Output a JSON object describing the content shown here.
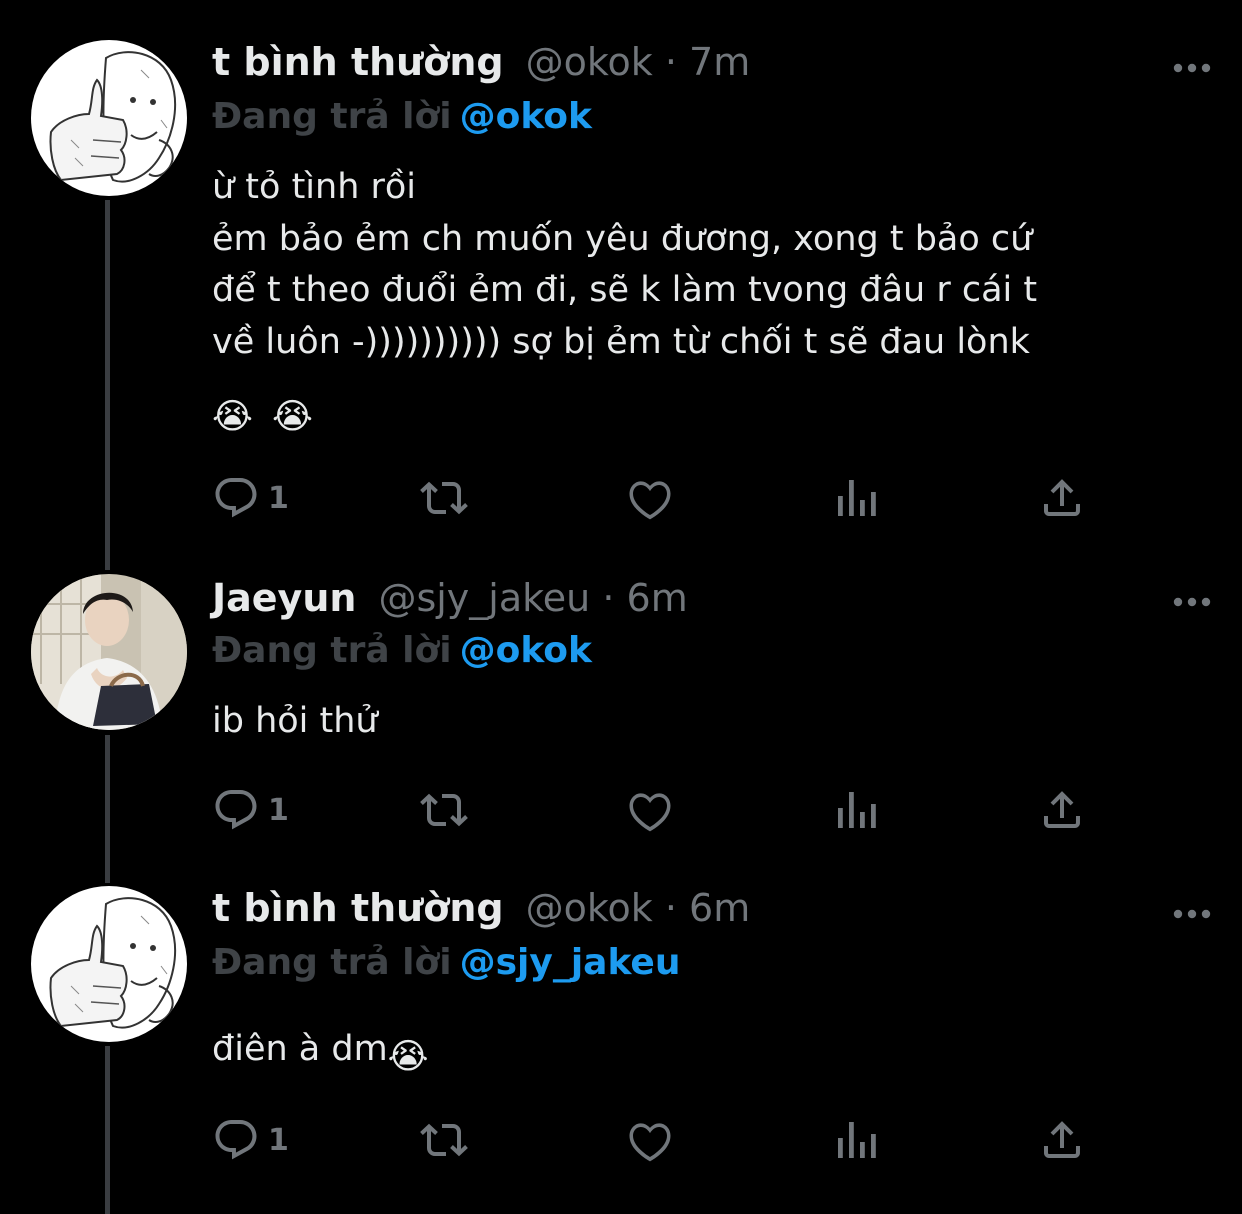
{
  "tweets": [
    {
      "display_name": "t bình thường",
      "handle": "@okok",
      "time": "7m",
      "reply_label": "Đang trả lời",
      "reply_to": "@okok",
      "body_lines": [
        "ừ tỏ tình rồi",
        "ẻm bảo ẻm ch muốn yêu đương, xong t bảo cứ",
        "để t theo đuổi ẻm đi, sẽ k làm tvong đâu r cái t",
        "về luôn -)))))))))) sợ bị ẻm từ chối t sẽ đau lònk"
      ],
      "emojis": [
        "😭",
        "😭"
      ],
      "reply_count": "1",
      "avatar": "drawn-thumbs-up-avatar"
    },
    {
      "display_name": "Jaeyun",
      "handle": "@sjy_jakeu",
      "time": "6m",
      "reply_label": "Đang trả lời",
      "reply_to": "@okok",
      "body_lines": [
        "ib hỏi thử"
      ],
      "reply_count": "1",
      "avatar": "photo-avatar"
    },
    {
      "display_name": "t bình thường",
      "handle": "@okok",
      "time": "6m",
      "reply_label": "Đang trả lời",
      "reply_to": "@sjy_jakeu",
      "body_text": "điên à dm",
      "body_emoji": "😭",
      "reply_count": "1",
      "avatar": "drawn-thumbs-up-avatar"
    }
  ],
  "separator": "·",
  "icons": {
    "reply": "reply-icon",
    "retweet": "retweet-icon",
    "like": "heart-icon",
    "views": "analytics-icon",
    "share": "share-icon",
    "more": "more-icon"
  },
  "colors": {
    "background": "#000000",
    "text": "#e7e9ea",
    "secondary": "#71767b",
    "accent": "#1d9bf0",
    "thread_line": "#3a3d41"
  }
}
